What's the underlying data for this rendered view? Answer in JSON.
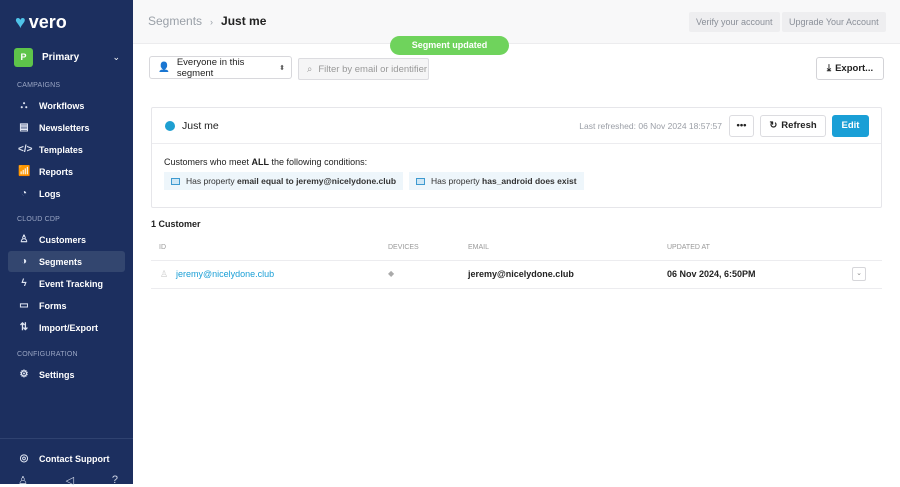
{
  "sidebar": {
    "brand": "vero",
    "workspace": {
      "initial": "P",
      "name": "Primary"
    },
    "sections": {
      "campaigns": "CAMPAIGNS",
      "cloud": "CLOUD CDP",
      "config": "CONFIGURATION"
    },
    "items": [
      {
        "label": "Workflows"
      },
      {
        "label": "Newsletters"
      },
      {
        "label": "Templates"
      },
      {
        "label": "Reports"
      },
      {
        "label": "Logs"
      },
      {
        "label": "Customers"
      },
      {
        "label": "Segments"
      },
      {
        "label": "Event Tracking"
      },
      {
        "label": "Forms"
      },
      {
        "label": "Import/Export"
      },
      {
        "label": "Settings"
      }
    ],
    "support": "Contact Support"
  },
  "header": {
    "breadcrumb_parent": "Segments",
    "breadcrumb_current": "Just me",
    "verify": "Verify your account",
    "upgrade": "Upgrade Your Account"
  },
  "toast": "Segment updated",
  "toolbar": {
    "select_value": "Everyone in this segment",
    "filter_placeholder": "Filter by email or identifier",
    "export": "Export..."
  },
  "card": {
    "title": "Just me",
    "last_refreshed": "Last refreshed: 06 Nov 2024 18:57:57",
    "more": "•••",
    "refresh": "Refresh",
    "edit": "Edit",
    "cond_prefix": "Customers who meet ",
    "cond_bold": "ALL",
    "cond_suffix": " the following conditions:",
    "conditions": [
      {
        "pre": "Has property ",
        "bold": "email equal to jeremy@nicelydone.club"
      },
      {
        "pre": "Has property ",
        "bold": "has_android does exist"
      }
    ]
  },
  "table": {
    "count": "1 Customer",
    "headers": [
      "ID",
      "DEVICES",
      "EMAIL",
      "UPDATED AT"
    ],
    "rows": [
      {
        "id": "jeremy@nicelydone.club",
        "email": "jeremy@nicelydone.club",
        "updated": "06 Nov 2024, 6:50PM"
      }
    ]
  }
}
